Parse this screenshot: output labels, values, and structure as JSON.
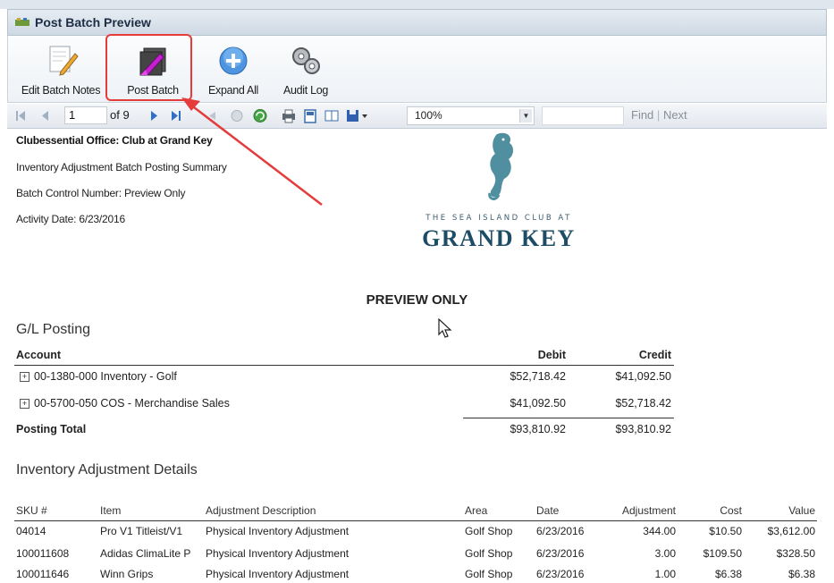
{
  "window": {
    "title": "Post Batch Preview"
  },
  "ribbon": {
    "buttons": [
      {
        "label": "Edit Batch Notes",
        "icon": "edit-notes-icon"
      },
      {
        "label": "Post Batch",
        "icon": "post-batch-icon"
      },
      {
        "label": "Expand All",
        "icon": "plus-circle-icon"
      },
      {
        "label": "Audit Log",
        "icon": "gears-icon"
      }
    ]
  },
  "report_toolbar": {
    "page": "1",
    "of_label": "of 9",
    "zoom": "100%",
    "find_label": "Find",
    "find_separator": "|",
    "next_label": "Next"
  },
  "report": {
    "club_title": "Clubessential Office: Club at Grand Key",
    "summary_title": "Inventory Adjustment Batch Posting Summary",
    "batch_control": "Batch Control Number: Preview Only",
    "activity_date": "Activity Date: 6/23/2016",
    "logo_line1": "THE SEA ISLAND CLUB AT",
    "logo_line2": "GRAND KEY",
    "preview_banner": "PREVIEW ONLY",
    "gl_section": "G/L Posting",
    "gl_headers": {
      "account": "Account",
      "debit": "Debit",
      "credit": "Credit"
    },
    "gl_rows": [
      {
        "account": "00-1380-000 Inventory - Golf",
        "debit": "$52,718.42",
        "credit": "$41,092.50"
      },
      {
        "account": "00-5700-050 COS - Merchandise Sales",
        "debit": "$41,092.50",
        "credit": "$52,718.42"
      }
    ],
    "gl_total": {
      "label": "Posting Total",
      "debit": "$93,810.92",
      "credit": "$93,810.92"
    },
    "details_section": "Inventory Adjustment Details",
    "detail_headers": [
      "SKU #",
      "Item",
      "Adjustment Description",
      "Area",
      "Date",
      "Adjustment",
      "Cost",
      "Value"
    ],
    "detail_rows": [
      [
        "04014",
        "Pro V1 Titleist/V1",
        "Physical Inventory Adjustment",
        "Golf Shop",
        "6/23/2016",
        "344.00",
        "$10.50",
        "$3,612.00"
      ],
      [
        "100011608",
        "Adidas ClimaLite P",
        "Physical Inventory Adjustment",
        "Golf Shop",
        "6/23/2016",
        "3.00",
        "$109.50",
        "$328.50"
      ],
      [
        "100011646",
        "Winn Grips",
        "Physical Inventory Adjustment",
        "Golf Shop",
        "6/23/2016",
        "1.00",
        "$6.38",
        "$6.38"
      ]
    ]
  },
  "colors": {
    "highlight": "#e53b3b",
    "brand": "#1d4d66"
  }
}
